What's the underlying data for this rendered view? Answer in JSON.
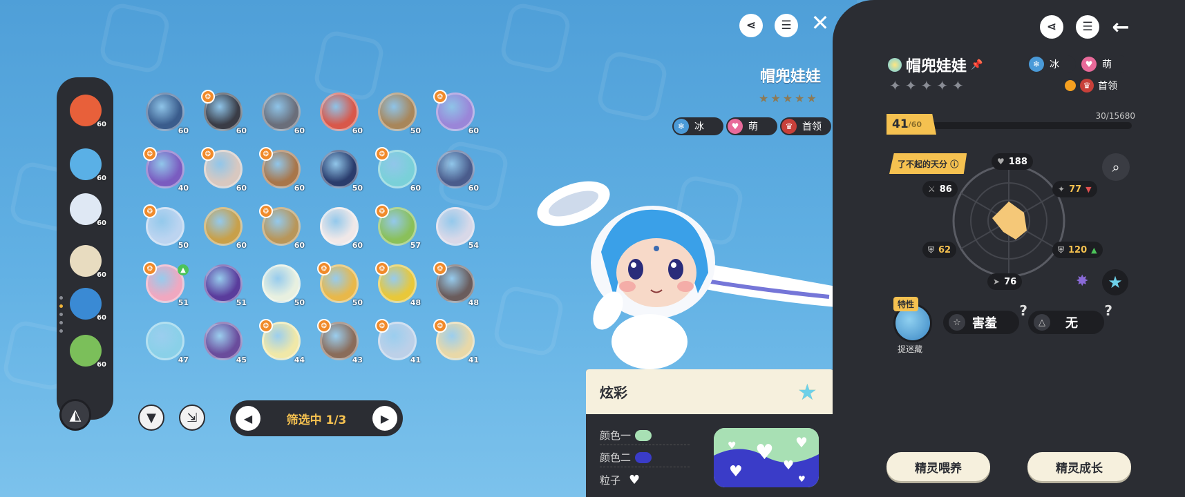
{
  "header": {
    "share_icon": "share-icon",
    "list_icon": "list-icon",
    "close_icon": "close-icon"
  },
  "rail": {
    "items": [
      {
        "level": "60",
        "color": "#e8603a"
      },
      {
        "level": "60",
        "color": "#5ab0e6",
        "badge": true
      },
      {
        "level": "60",
        "color": "#dfe8f4"
      },
      {
        "level": "60",
        "color": "#e8dcc0"
      },
      {
        "level": "60",
        "color": "#3a8ad4"
      },
      {
        "level": "60",
        "color": "#7bbf5a"
      }
    ]
  },
  "pets": [
    {
      "level": "60",
      "color": "#3a5c8c",
      "badge": false
    },
    {
      "level": "60",
      "color": "#3a3c46",
      "badge": true
    },
    {
      "level": "60",
      "color": "#6a6e7a",
      "badge": false
    },
    {
      "level": "60",
      "color": "#d8584a",
      "badge": false
    },
    {
      "level": "50",
      "color": "#a8865a",
      "badge": false
    },
    {
      "level": "60",
      "color": "#9a86d8",
      "badge": true
    },
    {
      "level": "40",
      "color": "#7a5cc0",
      "badge": true
    },
    {
      "level": "60",
      "color": "#d8c8c0",
      "badge": true
    },
    {
      "level": "60",
      "color": "#a8764a",
      "badge": true
    },
    {
      "level": "50",
      "color": "#2a3c6c",
      "badge": false
    },
    {
      "level": "60",
      "color": "#7ad0d8",
      "badge": true
    },
    {
      "level": "60",
      "color": "#4a5c8c",
      "badge": false
    },
    {
      "level": "50",
      "color": "#bcd4f0",
      "badge": true
    },
    {
      "level": "60",
      "color": "#c8a04a",
      "badge": false
    },
    {
      "level": "60",
      "color": "#b8965a",
      "badge": true
    },
    {
      "level": "60",
      "color": "#f0e8e8",
      "badge": false
    },
    {
      "level": "57",
      "color": "#8ac05a",
      "badge": true
    },
    {
      "level": "54",
      "color": "#d8d8e8",
      "badge": false
    },
    {
      "level": "51",
      "color": "#f0a8c0",
      "badge": true,
      "up": true
    },
    {
      "level": "51",
      "color": "#5a3c9c",
      "badge": false
    },
    {
      "level": "50",
      "color": "#e8f0e0",
      "badge": false
    },
    {
      "level": "50",
      "color": "#e8b84a",
      "badge": true
    },
    {
      "level": "48",
      "color": "#e8c83a",
      "badge": true
    },
    {
      "level": "48",
      "color": "#6a5c5c",
      "badge": true
    },
    {
      "level": "47",
      "color": "#8ad0e8",
      "badge": false
    },
    {
      "level": "45",
      "color": "#6a4c9c",
      "badge": false
    },
    {
      "level": "44",
      "color": "#f0e8a8",
      "badge": true
    },
    {
      "level": "43",
      "color": "#8a6c5a",
      "badge": true
    },
    {
      "level": "41",
      "color": "#bcd0e8",
      "badge": true
    },
    {
      "level": "41",
      "color": "#e8d8a8",
      "badge": true
    }
  ],
  "bottom": {
    "filter_icon": "filter-icon",
    "release_icon": "release-icon",
    "pager_text": "筛选中 1/3"
  },
  "center": {
    "name": "帽兜娃娃",
    "stars": "★★★★★",
    "tags": [
      {
        "label": "冰",
        "icon": "❄",
        "color": "#4a9ad8"
      },
      {
        "label": "萌",
        "icon": "♥",
        "color": "#e86a9a"
      },
      {
        "label": "首领",
        "icon": "♛",
        "color": "#c8403a"
      }
    ]
  },
  "color_panel": {
    "title": "炫彩",
    "rows": [
      {
        "label": "颜色一",
        "swatch": "#a8e0b4"
      },
      {
        "label": "颜色二",
        "swatch": "#3a3cc8"
      }
    ],
    "particle_label": "粒子",
    "particle_icon": "♥"
  },
  "detail": {
    "name": "帽兜娃娃",
    "stars": "✦✦✦✦✦",
    "types": [
      {
        "label": "冰",
        "icon": "❄",
        "color": "#4a9ad8"
      },
      {
        "label": "萌",
        "icon": "♥",
        "color": "#e86a9a"
      }
    ],
    "boss_label": "首领",
    "level_current": "41",
    "level_max": "/60",
    "exp_text": "30/15680",
    "talent_label": "了不起的天分",
    "stats": {
      "hp": "188",
      "atk": "86",
      "spatk": "77",
      "def": "62",
      "spdef": "120",
      "speed": "76"
    },
    "trait_label": "特性",
    "trait_name": "捉迷藏",
    "nature_1": "害羞",
    "nature_2": "无",
    "btn_feed": "精灵喂养",
    "btn_grow": "精灵成长"
  }
}
